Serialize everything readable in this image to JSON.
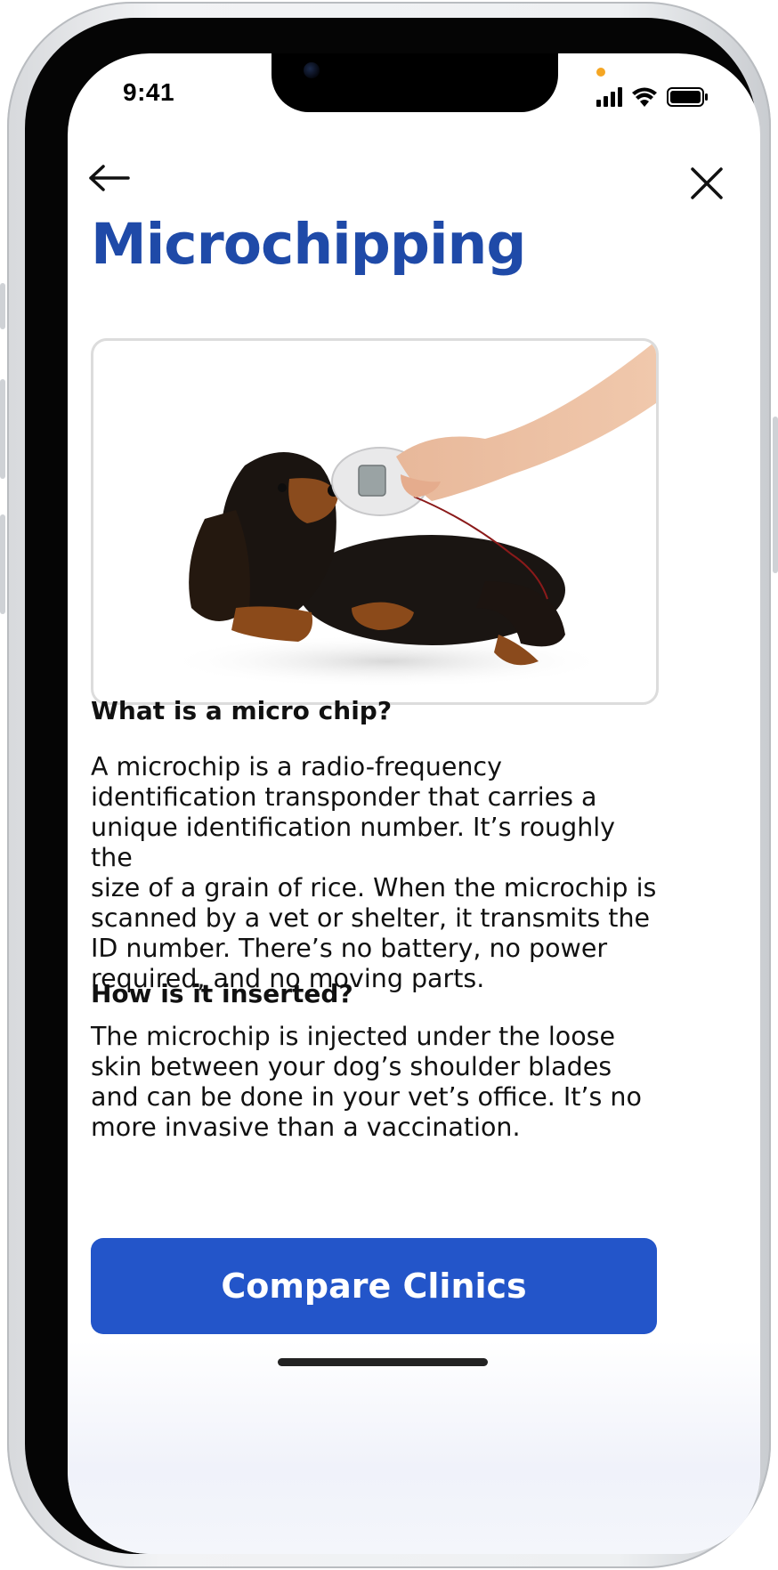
{
  "status_bar": {
    "time": "9:41"
  },
  "nav": {
    "back_icon": "arrow-left-icon",
    "close_icon": "close-icon"
  },
  "page": {
    "title": "Microchipping"
  },
  "hero_image": {
    "subject": "dog-being-scanned-photo"
  },
  "sections": [
    {
      "heading": "What is a micro chip?",
      "lines": [
        "A microchip is a radio-frequency",
        "identification transponder that carries a",
        "unique identification number. It’s roughly the",
        "size of a grain of rice. When the microchip is",
        "scanned by a vet or shelter, it transmits the",
        "ID number. There’s no battery, no power",
        "required, and no moving parts."
      ]
    },
    {
      "heading": "How is it inserted?",
      "lines": [
        "The microchip is injected under the loose",
        "skin between your dog’s shoulder blades",
        "and can be done in your vet’s office. It’s no",
        "more invasive than a vaccination."
      ]
    }
  ],
  "cta": {
    "label": "Compare Clinics"
  },
  "colors": {
    "title": "#1f4aa8",
    "button": "#2355c9",
    "accent_dot": "#f5a623"
  }
}
